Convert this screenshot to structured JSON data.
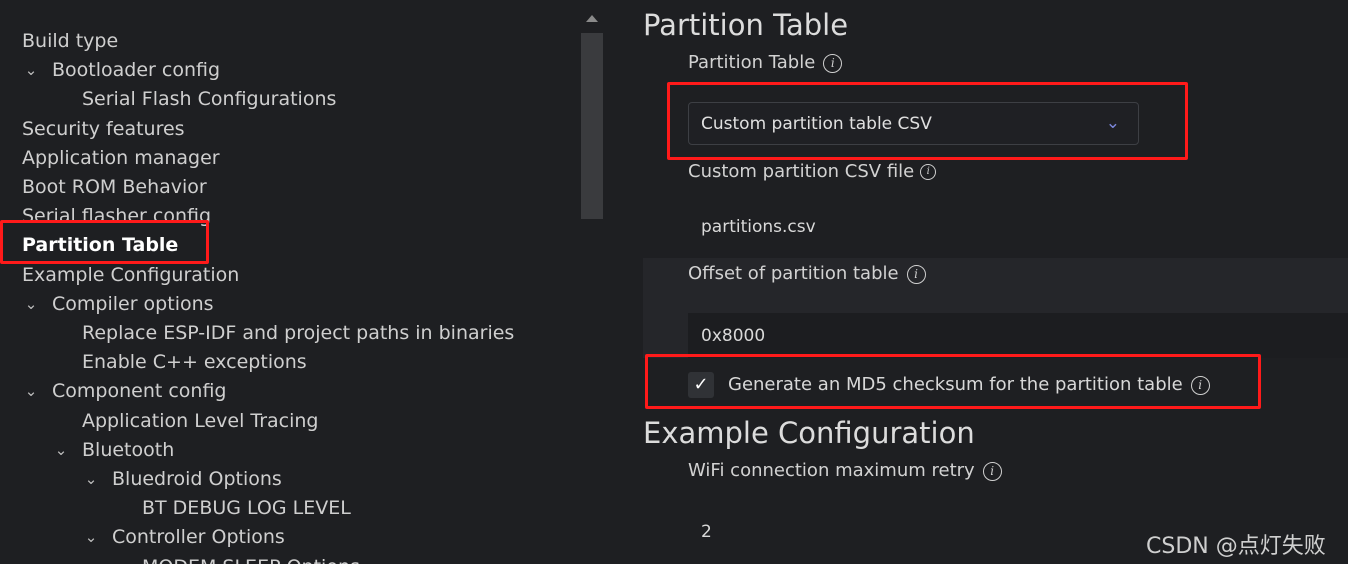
{
  "sidebar": {
    "items": [
      {
        "label": "Build type",
        "level": 0,
        "expandable": false
      },
      {
        "label": "Bootloader config",
        "level": 0,
        "expandable": true
      },
      {
        "label": "Serial Flash Configurations",
        "level": 1,
        "expandable": false
      },
      {
        "label": "Security features",
        "level": 0,
        "expandable": false
      },
      {
        "label": "Application manager",
        "level": 0,
        "expandable": false
      },
      {
        "label": "Boot ROM Behavior",
        "level": 0,
        "expandable": false
      },
      {
        "label": "Serial flasher config",
        "level": 0,
        "expandable": false
      },
      {
        "label": "Partition Table",
        "level": 0,
        "expandable": false,
        "active": true
      },
      {
        "label": "Example Configuration",
        "level": 0,
        "expandable": false
      },
      {
        "label": "Compiler options",
        "level": 0,
        "expandable": true
      },
      {
        "label": "Replace ESP-IDF and project paths in binaries",
        "level": 1,
        "expandable": false
      },
      {
        "label": "Enable C++ exceptions",
        "level": 1,
        "expandable": false
      },
      {
        "label": "Component config",
        "level": 0,
        "expandable": true
      },
      {
        "label": "Application Level Tracing",
        "level": 1,
        "expandable": false
      },
      {
        "label": "Bluetooth",
        "level": 1,
        "expandable": true
      },
      {
        "label": "Bluedroid Options",
        "level": 2,
        "expandable": true
      },
      {
        "label": "BT DEBUG LOG LEVEL",
        "level": 3,
        "expandable": false
      },
      {
        "label": "Controller Options",
        "level": 2,
        "expandable": true
      },
      {
        "label": "MODEM SLEEP Options",
        "level": 3,
        "expandable": false
      }
    ]
  },
  "main": {
    "partition_section_title": "Partition Table",
    "partition_table_label": "Partition Table",
    "partition_table_value": "Custom partition table CSV",
    "custom_csv_label": "Custom partition CSV file",
    "custom_csv_value": "partitions.csv",
    "offset_label": "Offset of partition table",
    "offset_value": "0x8000",
    "md5_checked": true,
    "md5_label": "Generate an MD5 checksum for the partition table",
    "example_section_title": "Example Configuration",
    "wifi_retry_label": "WiFi connection maximum retry",
    "wifi_retry_value": "2"
  },
  "icons": {
    "info": "i",
    "chevron_down": "⌄",
    "check": "✓"
  },
  "colors": {
    "highlight": "#ff1a1a",
    "accent_chevron": "#7b86d9"
  },
  "watermark": "CSDN @点灯失败"
}
